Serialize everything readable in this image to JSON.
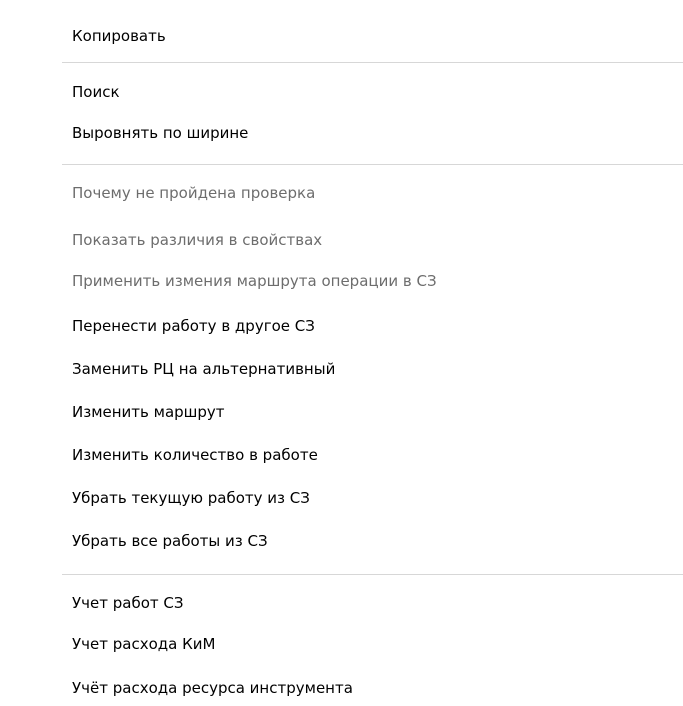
{
  "context_menu": {
    "groups": [
      {
        "items": [
          {
            "label": "Копировать",
            "enabled": true
          }
        ]
      },
      {
        "items": [
          {
            "label": "Поиск",
            "enabled": true
          },
          {
            "label": "Выровнять по ширине",
            "enabled": true
          }
        ]
      },
      {
        "items": [
          {
            "label": "Почему не пройдена проверка",
            "enabled": false
          },
          {
            "label": "Показать различия в свойствах",
            "enabled": false
          },
          {
            "label": "Применить измения маршрута операции в СЗ",
            "enabled": false
          },
          {
            "label": "Перенести работу в другое СЗ",
            "enabled": true
          },
          {
            "label": "Заменить РЦ на альтернативный",
            "enabled": true
          },
          {
            "label": "Изменить маршрут",
            "enabled": true
          },
          {
            "label": "Изменить количество в работе",
            "enabled": true
          },
          {
            "label": "Убрать текущую работу из  СЗ",
            "enabled": true
          },
          {
            "label": "Убрать все работы из  СЗ",
            "enabled": true
          }
        ]
      },
      {
        "items": [
          {
            "label": "Учет работ СЗ",
            "enabled": true
          },
          {
            "label": "Учет расхода КиМ",
            "enabled": true
          },
          {
            "label": "Учёт расхода ресурса инструмента",
            "enabled": true
          }
        ]
      }
    ],
    "colors": {
      "background": "#ffffff",
      "text": "#000000",
      "disabled_text": "#6d6d6d",
      "separator": "#d7d7d7"
    }
  }
}
